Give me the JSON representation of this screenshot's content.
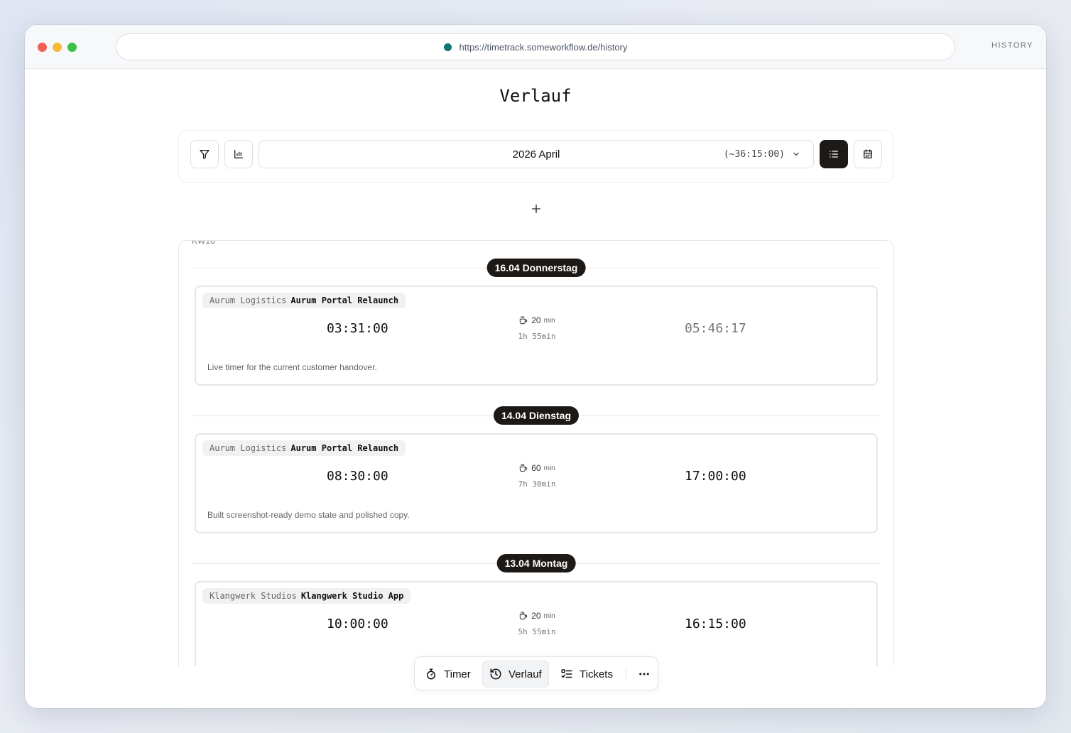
{
  "browser": {
    "url": "https://timetrack.someworkflow.de/history",
    "window_label": "HISTORY"
  },
  "page": {
    "title": "Verlauf"
  },
  "toolbar": {
    "month_label": "2026 April",
    "month_total": "(~36:15:00)"
  },
  "week": {
    "label": "KW16",
    "days": [
      {
        "label": "16.04 Donnerstag",
        "entries": [
          {
            "client": "Aurum Logistics",
            "project": "Aurum Portal Relaunch",
            "start": "03:31:00",
            "break_value": "20",
            "break_unit": "min",
            "duration": "1h 55min",
            "end": "05:46:17",
            "note": "Live timer for the current customer handover."
          }
        ]
      },
      {
        "label": "14.04 Dienstag",
        "entries": [
          {
            "client": "Aurum Logistics",
            "project": "Aurum Portal Relaunch",
            "start": "08:30:00",
            "break_value": "60",
            "break_unit": "min",
            "duration": "7h 30min",
            "end": "17:00:00",
            "note": "Built screenshot-ready demo state and polished copy."
          }
        ]
      },
      {
        "label": "13.04 Montag",
        "entries": [
          {
            "client": "Klangwerk Studios",
            "project": "Klangwerk Studio App",
            "start": "10:00:00",
            "break_value": "20",
            "break_unit": "min",
            "duration": "5h 55min",
            "end": "16:15:00",
            "note": ""
          }
        ]
      }
    ]
  },
  "nav": {
    "timer": "Timer",
    "history": "Verlauf",
    "tickets": "Tickets"
  }
}
